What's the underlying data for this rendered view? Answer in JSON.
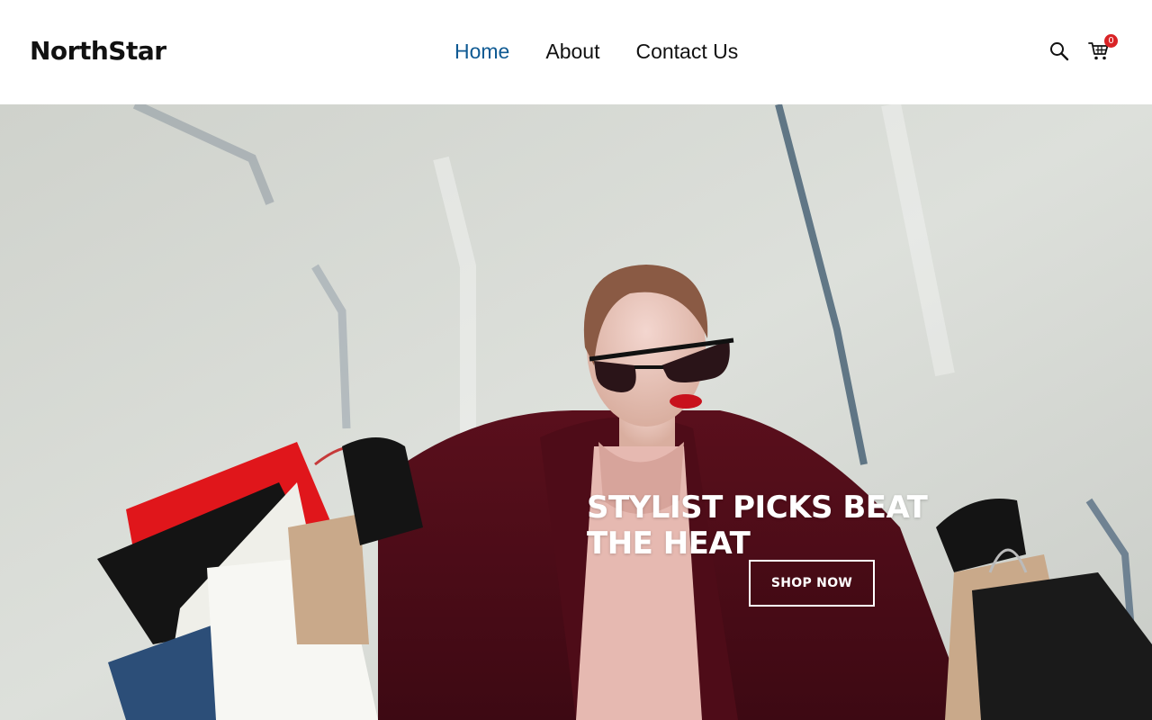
{
  "brand": {
    "name": "NorthStar"
  },
  "nav": {
    "items": [
      {
        "label": "Home",
        "active": true
      },
      {
        "label": "About",
        "active": false
      },
      {
        "label": "Contact Us",
        "active": false
      }
    ]
  },
  "header_icons": {
    "search": "search-icon",
    "cart": "cart-icon",
    "cart_count": "0"
  },
  "hero": {
    "title": "STYLIST PICKS BEAT THE HEAT",
    "cta_label": "SHOP NOW",
    "image": "woman-with-shopping-bags"
  },
  "colors": {
    "nav_active": "#0f5a93",
    "badge": "#d92326",
    "hero_text": "#ffffff"
  }
}
